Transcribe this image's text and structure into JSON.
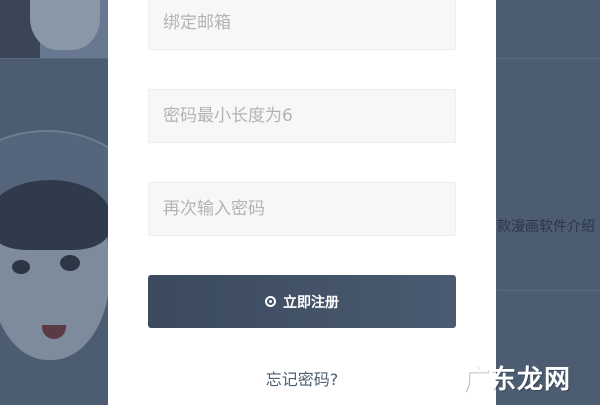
{
  "form": {
    "email_placeholder": "绑定邮箱",
    "password_placeholder": "密码最小长度为6",
    "confirm_placeholder": "再次输入密码",
    "submit_label": "立即注册",
    "submit_icon": "radio-dot-icon",
    "forgot_label": "忘记密码?"
  },
  "background": {
    "partial_text": "款漫画软件介绍"
  },
  "watermark": "广东龙网",
  "colors": {
    "overlay_bg": "#4c5d72",
    "button_bg": "#3b4a5e",
    "link_color": "#4e5e73",
    "field_bg": "#f7f7f7"
  }
}
